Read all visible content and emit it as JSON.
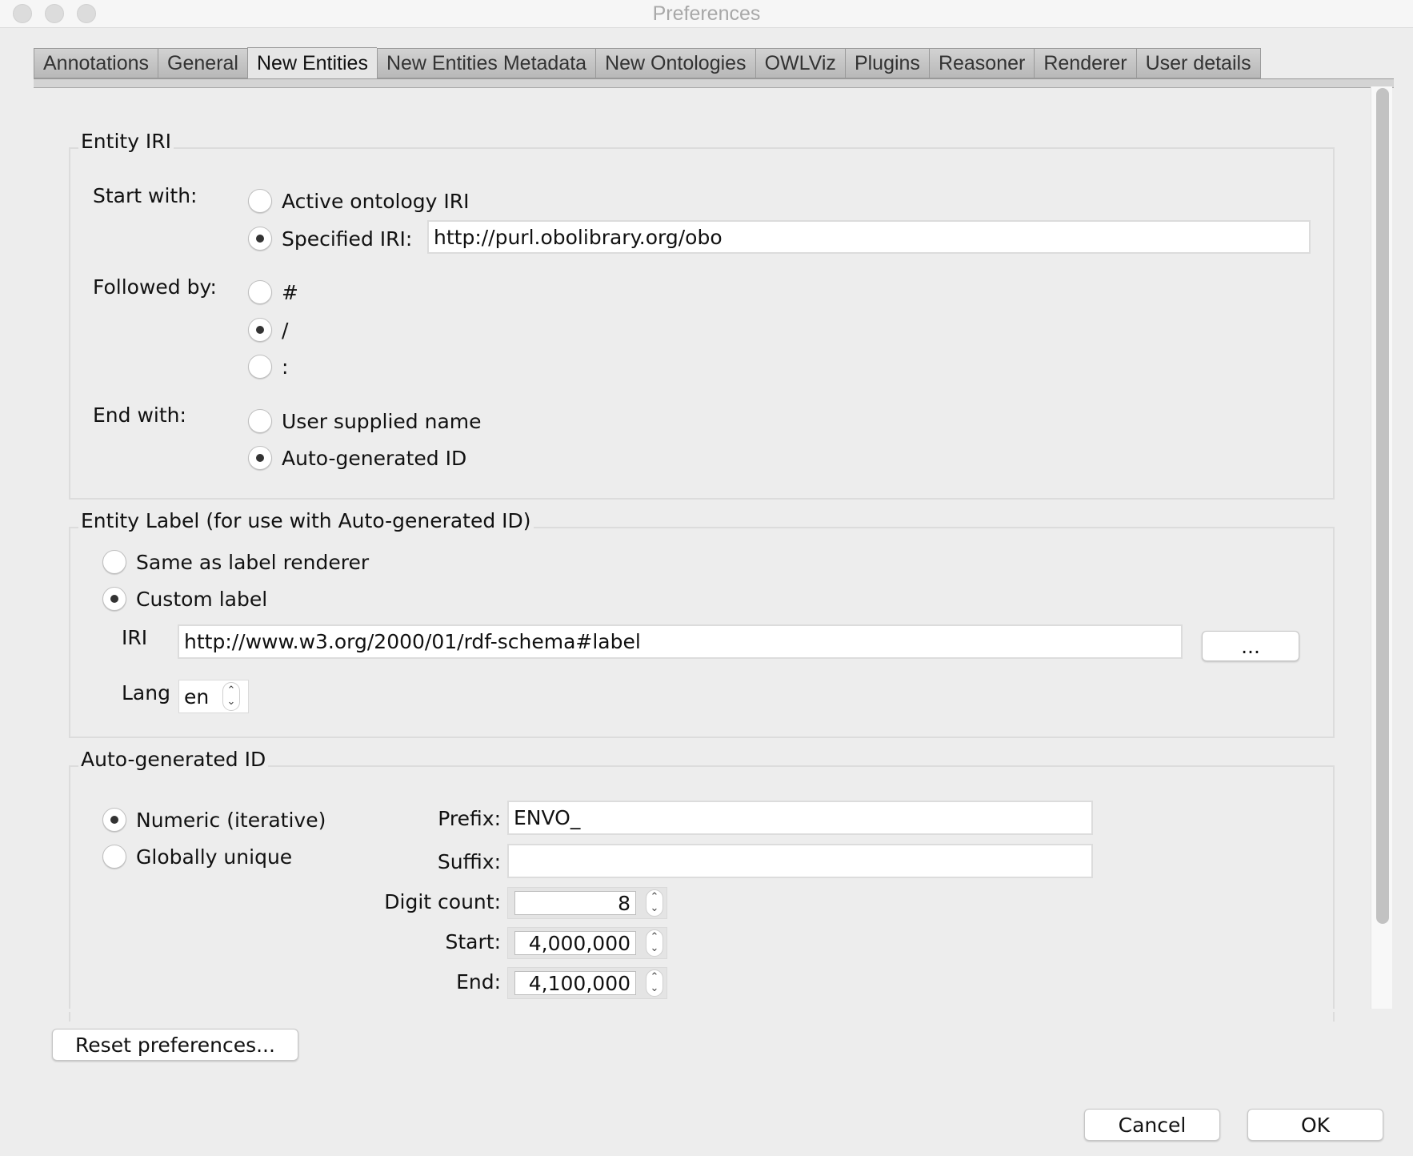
{
  "window": {
    "title": "Preferences"
  },
  "tabs": [
    {
      "label": "Annotations",
      "active": false
    },
    {
      "label": "General",
      "active": false
    },
    {
      "label": "New Entities",
      "active": true
    },
    {
      "label": "New Entities Metadata",
      "active": false
    },
    {
      "label": "New Ontologies",
      "active": false
    },
    {
      "label": "OWLViz",
      "active": false
    },
    {
      "label": "Plugins",
      "active": false
    },
    {
      "label": "Reasoner",
      "active": false
    },
    {
      "label": "Renderer",
      "active": false
    },
    {
      "label": "User details",
      "active": false
    }
  ],
  "entity_iri": {
    "title": "Entity IRI",
    "start_with": {
      "label": "Start with:",
      "options": [
        {
          "label": "Active ontology IRI",
          "checked": false
        },
        {
          "label": "Specified IRI:",
          "checked": true
        }
      ],
      "specified_iri_value": "http://purl.obolibrary.org/obo"
    },
    "followed_by": {
      "label": "Followed by:",
      "options": [
        {
          "label": "#",
          "checked": false
        },
        {
          "label": "/",
          "checked": true
        },
        {
          "label": ":",
          "checked": false
        }
      ]
    },
    "end_with": {
      "label": "End with:",
      "options": [
        {
          "label": "User supplied name",
          "checked": false
        },
        {
          "label": "Auto-generated ID",
          "checked": true
        }
      ]
    }
  },
  "entity_label": {
    "title": "Entity Label (for use with Auto-generated ID)",
    "options": [
      {
        "label": "Same as label renderer",
        "checked": false
      },
      {
        "label": "Custom label",
        "checked": true
      }
    ],
    "iri_label": "IRI",
    "iri_value": "http://www.w3.org/2000/01/rdf-schema#label",
    "browse_label": "...",
    "lang_label": "Lang",
    "lang_value": "en"
  },
  "auto_id": {
    "title": "Auto-generated ID",
    "options": [
      {
        "label": "Numeric (iterative)",
        "checked": true
      },
      {
        "label": "Globally unique",
        "checked": false
      }
    ],
    "prefix_label": "Prefix:",
    "prefix_value": "ENVO_",
    "suffix_label": "Suffix:",
    "suffix_value": "",
    "digit_count_label": "Digit count:",
    "digit_count_value": "8",
    "start_label": "Start:",
    "start_value": "4,000,000",
    "end_label": "End:",
    "end_value": "4,100,000"
  },
  "buttons": {
    "reset": "Reset preferences...",
    "cancel": "Cancel",
    "ok": "OK"
  }
}
